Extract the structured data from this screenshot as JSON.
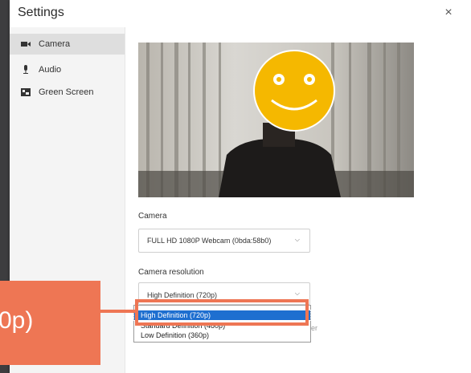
{
  "dialog": {
    "title": "Settings",
    "close_glyph": "×"
  },
  "sidebar": {
    "items": [
      {
        "label": "Camera",
        "icon": "video-camera-icon",
        "active": true
      },
      {
        "label": "Audio",
        "icon": "microphone-icon",
        "active": false
      },
      {
        "label": "Green Screen",
        "icon": "green-screen-icon",
        "active": false
      }
    ]
  },
  "camera": {
    "section_label": "Camera",
    "selected_device": "FULL HD 1080P Webcam (0bda:58b0)",
    "chevron": "⌵"
  },
  "resolution": {
    "section_label": "Camera resolution",
    "selected_value": "High Definition (720p)",
    "chevron": "⌵",
    "options": [
      {
        "label": "High Definition (720p)",
        "selected": true
      },
      {
        "label": "Standard Definition (480p)",
        "selected": false
      },
      {
        "label": "Low Definition (360p)",
        "selected": false
      }
    ],
    "trailing_hint": "er"
  },
  "callout": {
    "text": "0p)"
  },
  "colors": {
    "accent_orange": "#ee7654",
    "selection_blue": "#1e6fd0",
    "emoji_yellow": "#f5b800"
  }
}
